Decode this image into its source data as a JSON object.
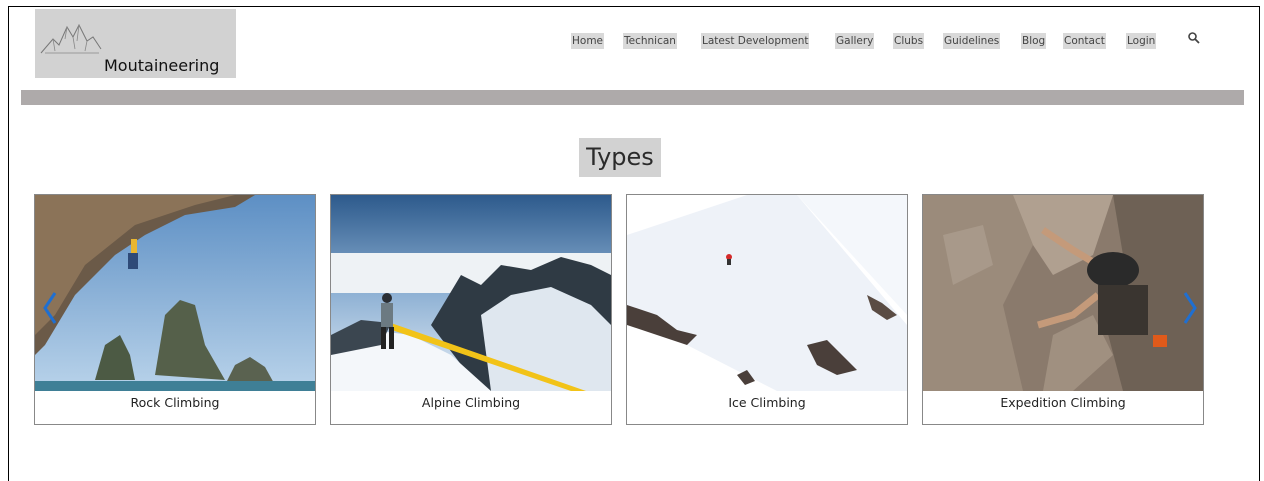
{
  "header": {
    "logo_text": "Moutaineering",
    "nav": [
      {
        "label": "Home"
      },
      {
        "label": "Technican"
      },
      {
        "label": "Latest Development"
      },
      {
        "label": "Gallery"
      },
      {
        "label": "Clubs"
      },
      {
        "label": "Guidelines"
      },
      {
        "label": "Blog"
      },
      {
        "label": "Contact"
      },
      {
        "label": "Login"
      }
    ],
    "search_icon": "search-icon"
  },
  "main": {
    "section_title": "Types",
    "cards": [
      {
        "label": "Rock Climbing"
      },
      {
        "label": "Alpine Climbing"
      },
      {
        "label": "Ice Climbing"
      },
      {
        "label": "Expedition Climbing"
      }
    ],
    "carousel": {
      "prev_icon": "chevron-left-icon",
      "next_icon": "chevron-right-icon",
      "arrow_color": "#1f6fd1"
    }
  },
  "colors": {
    "logo_bg": "#d2d2d2",
    "divider": "#aeaaaa",
    "nav_bg": "#d9d9d9"
  }
}
